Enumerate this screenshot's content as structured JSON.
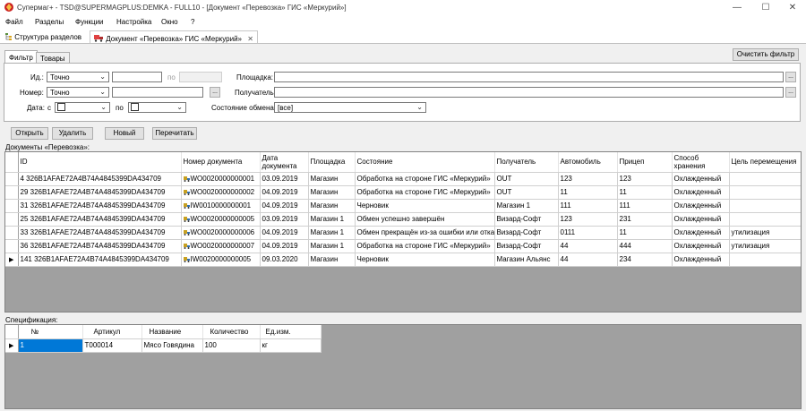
{
  "window": {
    "title": "Супермаг+ - TSD@SUPERMAGPLUS:DEMKA - FULL10 - [Документ «Перевозка» ГИС «Меркурий»]",
    "minimize": "—",
    "maximize": "☐",
    "close": "✕"
  },
  "menu": [
    "Файл",
    "Разделы",
    "Функции",
    "Настройка",
    "Окно",
    "?"
  ],
  "doc_tabs": {
    "tab1": "Структура разделов",
    "tab2": "Документ «Перевозка» ГИС «Меркурий»",
    "tab2_close": "✕"
  },
  "filter_tabs": [
    "Фильтр",
    "Товары"
  ],
  "clear_filter": "Очистить фильтр",
  "filter": {
    "id_label": "Ид.:",
    "id_mode": "Точно",
    "to_label": "по",
    "number_label": "Номер:",
    "number_mode": "Точно",
    "browse": "...",
    "date_label": "Дата:",
    "date_from_label": "с",
    "date_to_label": "по",
    "place_label": "Площадка:",
    "receiver_label": "Получатель:",
    "state_label": "Состояние обмена:",
    "state_value": "[все]"
  },
  "actions": [
    "Открыть",
    "Удалить",
    "Новый",
    "Перечитать"
  ],
  "docs_caption": "Документы «Перевозка»:",
  "docs_table": {
    "headers": [
      "ID",
      "Номер документа",
      "Дата документа",
      "Площадка",
      "Состояние",
      "Получатель",
      "Автомобиль",
      "Прицеп",
      "Способ хранения",
      "Цель перемещения"
    ],
    "rows": [
      [
        "4 326B1AFAE72A4B74A4845399DA434709",
        "WO0020000000001",
        "03.09.2019",
        "Магазин",
        "Обработка на стороне ГИС «Меркурий»",
        "OUT",
        "123",
        "123",
        "Охлажденный",
        ""
      ],
      [
        "29 326B1AFAE72A4B74A4845399DA434709",
        "WO0020000000002",
        "04.09.2019",
        "Магазин",
        "Обработка на стороне ГИС «Меркурий»",
        "OUT",
        "11",
        "11",
        "Охлажденный",
        ""
      ],
      [
        "31 326B1AFAE72A4B74A4845399DA434709",
        "IW0010000000001",
        "04.09.2019",
        "Магазин",
        "Черновик",
        "Магазин 1",
        "111",
        "111",
        "Охлажденный",
        ""
      ],
      [
        "25 326B1AFAE72A4B74A4845399DA434709",
        "WO0020000000005",
        "03.09.2019",
        "Магазин 1",
        "Обмен успешно завершён",
        "Визард-Софт",
        "123",
        "231",
        "Охлажденный",
        ""
      ],
      [
        "33 326B1AFAE72A4B74A4845399DA434709",
        "WO0020000000006",
        "04.09.2019",
        "Магазин 1",
        "Обмен прекращён из-за ошибки или отказа",
        "Визард-Софт",
        "0111",
        "11",
        "Охлажденный",
        "утилизация"
      ],
      [
        "36 326B1AFAE72A4B74A4845399DA434709",
        "WO0020000000007",
        "04.09.2019",
        "Магазин 1",
        "Обработка на стороне ГИС «Меркурий»",
        "Визард-Софт",
        "44",
        "444",
        "Охлажденный",
        "утилизация"
      ],
      [
        "141 326B1AFAE72A4B74A4845399DA434709",
        "IW0020000000005",
        "09.03.2020",
        "Магазин",
        "Черновик",
        "Магазин Альянс",
        "44",
        "234",
        "Охлажденный",
        ""
      ]
    ],
    "current_marker": "▶"
  },
  "spec_caption": "Спецификация:",
  "spec_table": {
    "headers": [
      "№",
      "Артикул",
      "Название",
      "Количество",
      "Ед.изм."
    ],
    "rows": [
      [
        "1",
        "T000014",
        "Мясо Говядина",
        "100",
        "кг"
      ]
    ],
    "current_marker": "▶"
  },
  "colors": {
    "selection": "#0078d7",
    "grid_background": "#a0a0a0",
    "app_logo": "#cc2222"
  }
}
